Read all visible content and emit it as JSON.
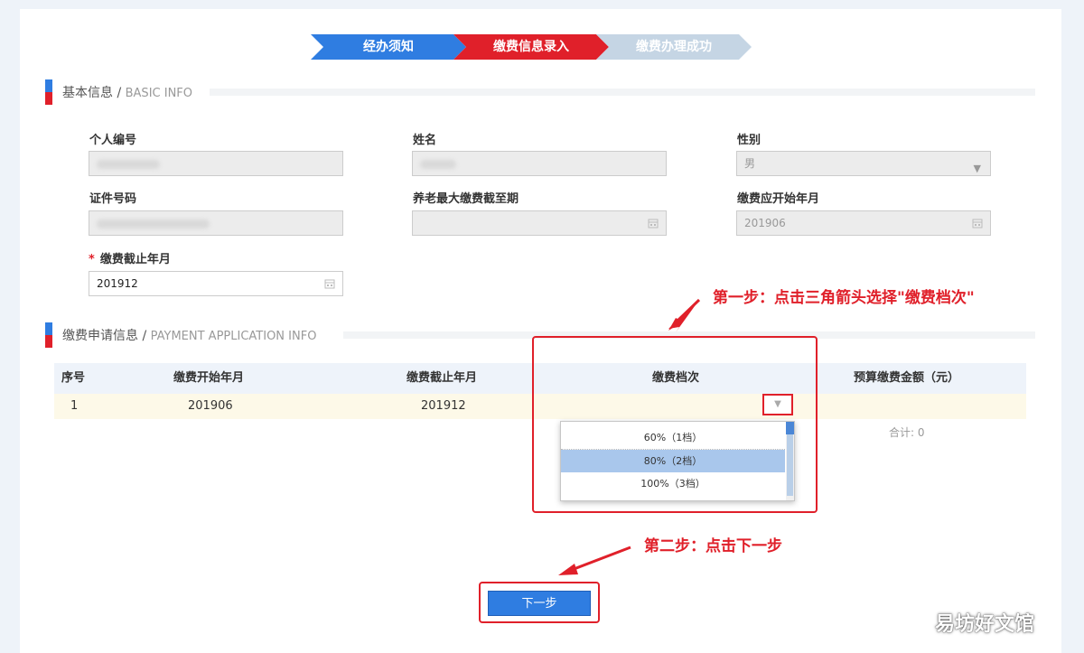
{
  "steps": [
    "经办须知",
    "缴费信息录入",
    "缴费办理成功"
  ],
  "basic_section": {
    "title": "基本信息",
    "title_en": "BASIC INFO"
  },
  "form": {
    "personal_id": {
      "label": "个人编号"
    },
    "name": {
      "label": "姓名"
    },
    "gender": {
      "label": "性别",
      "value": "男"
    },
    "id_number": {
      "label": "证件号码"
    },
    "max_end": {
      "label": "养老最大缴费截至期"
    },
    "start_month": {
      "label": "缴费应开始年月",
      "value": "201906"
    },
    "end_month": {
      "label": "缴费截止年月",
      "required_mark": "*",
      "value": "201912"
    }
  },
  "payment_section": {
    "title": "缴费申请信息",
    "title_en": "PAYMENT APPLICATION INFO"
  },
  "table": {
    "headers": [
      "序号",
      "缴费开始年月",
      "缴费截止年月",
      "缴费档次",
      "预算缴费金额（元）"
    ],
    "rows": [
      {
        "index": "1",
        "start": "201906",
        "end": "201912",
        "level": "",
        "amount": ""
      }
    ],
    "total": "合计: 0"
  },
  "dropdown": {
    "options": [
      "60%（1档）",
      "80%（2档）",
      "100%（3档）"
    ],
    "highlighted": "80%（2档）"
  },
  "annotations": {
    "step1": "第一步：点击三角箭头选择\"缴费档次\"",
    "step2": "第二步：点击下一步"
  },
  "next_button": "下一步",
  "watermark": "易坊好文馆",
  "colors": {
    "primary": "#2f7de1",
    "accent_red": "#e0202a",
    "inactive_step": "#c5d5e4"
  }
}
